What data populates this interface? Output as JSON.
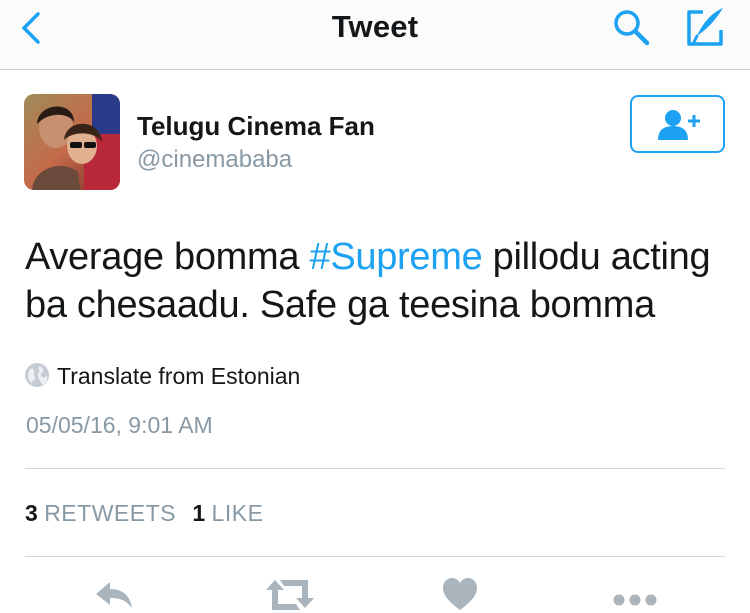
{
  "navbar": {
    "title": "Tweet",
    "back_icon": "chevron-left-icon",
    "search_icon": "search-icon",
    "compose_icon": "compose-icon"
  },
  "author": {
    "display_name": "Telugu Cinema Fan",
    "handle": "@cinemababa",
    "follow_icon": "add-user-icon"
  },
  "tweet": {
    "text_before": "Average bomma ",
    "hashtag": "#Supreme",
    "text_after": " pillodu acting ba chesaadu. Safe ga teesina bomma",
    "translate_label": "Translate from Estonian",
    "timestamp": "05/05/16, 9:01 AM"
  },
  "stats": {
    "retweets_count": "3",
    "retweets_label": "RETWEETS",
    "likes_count": "1",
    "likes_label": "LIKE"
  },
  "actions": [
    "reply-icon",
    "retweet-icon",
    "like-icon",
    "more-icon"
  ],
  "colors": {
    "accent": "#1da1f2",
    "text": "#14171a",
    "secondary": "#8899a6",
    "icon_gray": "#a9b4bd"
  }
}
